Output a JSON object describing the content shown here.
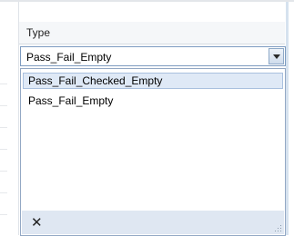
{
  "header": {
    "column_label": "Type"
  },
  "field": {
    "selected_value": "Pass_Fail_Empty"
  },
  "dropdown": {
    "options": [
      {
        "label": "Pass_Fail_Checked_Empty",
        "highlighted": true
      },
      {
        "label": "Pass_Fail_Empty",
        "highlighted": false
      }
    ],
    "close_label": "✕"
  },
  "colors": {
    "highlight_background": "#dfe9f6",
    "footer_background": "#dfe7f2",
    "field_border": "#7d9bc0"
  },
  "icons": {
    "dropdown_button": "chevron-down-icon",
    "close": "close-icon",
    "resize": "resize-grip-icon"
  }
}
